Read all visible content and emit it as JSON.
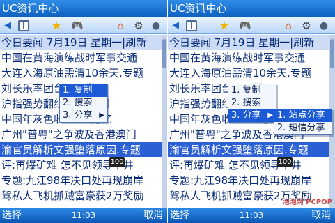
{
  "app_title": "UC资讯中心",
  "toolbar": {
    "icons": [
      "back-arrow-icon",
      "book-icon",
      "star-icon",
      "gamepad-icon",
      "home-icon",
      "gear-icon",
      "user-icon"
    ]
  },
  "news": {
    "date_line": "今日要闻 7月19日 星期一|刷新",
    "lines": [
      "中国在黄海演练战时军事交通",
      "大连入海原油需清10余天.专题",
      "刘长乐率团台开展学习",
      "沪指强势翻红 抵线冲刺",
      "中国年灰色收入4.7万亿",
      "广州\"普粤\"之争波及香港澳门",
      "渝官员解析文强堕落原因.专题",
      "评:再爆矿难 怎不见领导下井",
      "专题:九江98年决口处再现崩岸",
      "驾私人飞机抓贼富豪获2万奖励"
    ]
  },
  "context_menu": {
    "items": [
      "1. 复制",
      "2. 搜索",
      "3. 分享"
    ]
  },
  "share_submenu": {
    "items": [
      "1. 站点分享",
      "2. 短信分享"
    ]
  },
  "badge": "100",
  "softkeys": {
    "left": "选择",
    "time": "11:03",
    "right": "取消"
  },
  "watermark": "泡泡网 PCPOP",
  "colors": {
    "title_bar": "#1c74d8",
    "highlight": "#2b60d4",
    "text": "#0a2d7a"
  }
}
